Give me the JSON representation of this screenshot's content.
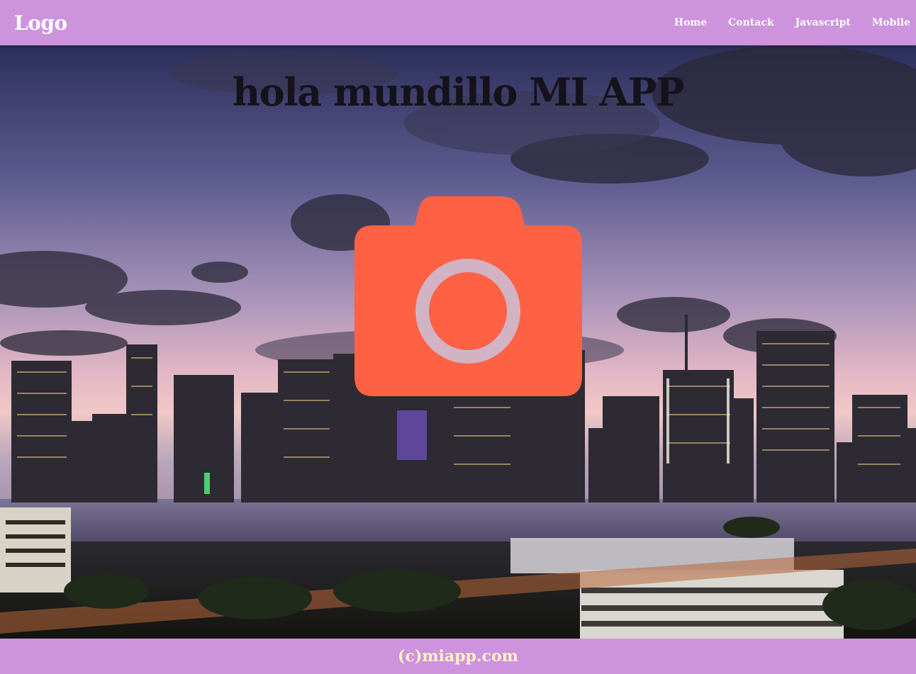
{
  "header": {
    "logo": "Logo",
    "nav": [
      "Home",
      "Contack",
      "Javascript",
      "Mobile"
    ]
  },
  "hero": {
    "title": "hola mundillo MI APP",
    "icon": "camera-icon",
    "icon_color": "#ff6145"
  },
  "footer": {
    "copyright": "(c)miapp.com"
  },
  "colors": {
    "header_bg": "#ce93dd",
    "footer_bg": "#ce93dd",
    "footer_text": "#fff2c8"
  }
}
